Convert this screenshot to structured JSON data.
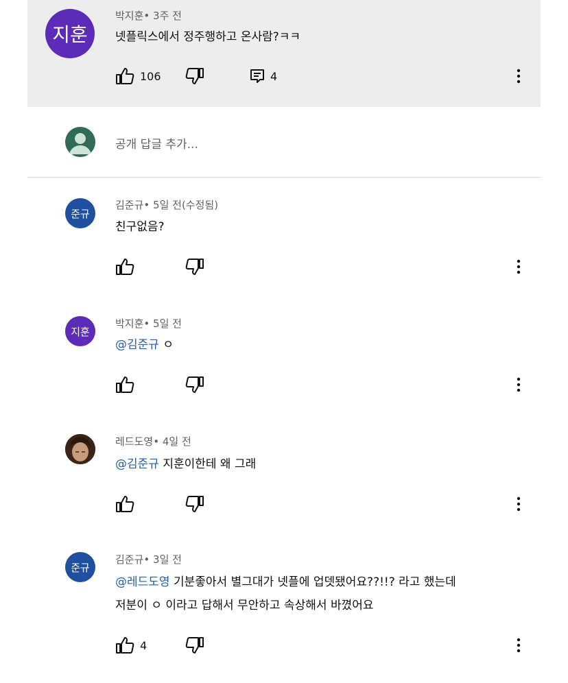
{
  "parent": {
    "avatar_text": "지훈",
    "avatar_color": "#5c2bb8",
    "author": "박지훈",
    "time": "3주 전",
    "text": "넷플릭스에서 정주행하고 온사람?ㅋㅋ",
    "likes": "106",
    "replies": "4"
  },
  "reply_input": {
    "placeholder": "공개 답글 추가..."
  },
  "replies": [
    {
      "avatar_text": "준규",
      "avatar_color": "#1f4f9e",
      "author": "김준규",
      "time": "5일 전(수정됨)",
      "text": "친구없음?",
      "likes": ""
    },
    {
      "avatar_text": "지훈",
      "avatar_color": "#5c2bb8",
      "author": "박지훈",
      "time": "5일 전",
      "mention": "@김준규",
      "text": "ㅇ",
      "likes": ""
    },
    {
      "avatar_text": "",
      "avatar_color": "#5a3a2a",
      "author": "레드도영",
      "time": "4일 전",
      "mention": "@김준규",
      "text": "지훈이한테 왜 그래",
      "likes": ""
    },
    {
      "avatar_text": "준규",
      "avatar_color": "#1f4f9e",
      "author": "김준규",
      "time": "3일 전",
      "mention": "@레드도영",
      "text": "기분좋아서 별그대가 넷플에 업뎃됐어요??!!? 라고 했는데",
      "text2": "저분이 ㅇ 이라고 답해서 무안하고 속상해서 바꼈어요",
      "likes": "4"
    }
  ],
  "separator": "•",
  "icons": {
    "like": "thumbs-up-icon",
    "dislike": "thumbs-down-icon",
    "reply": "reply-comment-icon",
    "more": "more-vertical-icon"
  }
}
